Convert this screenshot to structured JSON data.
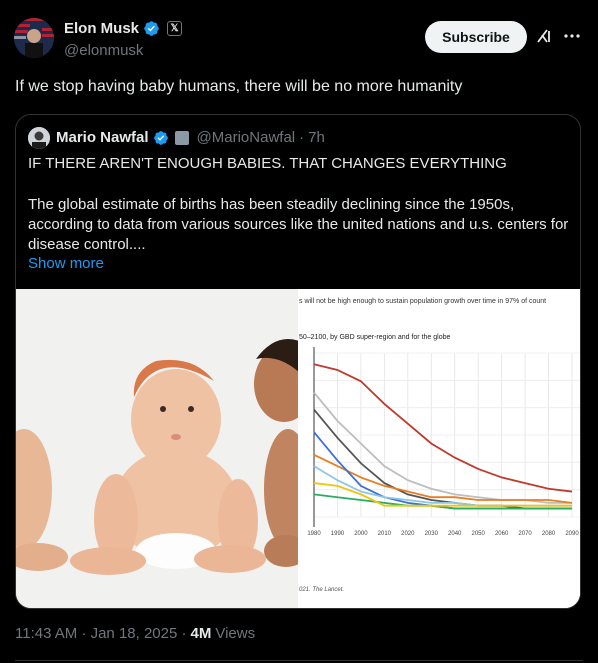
{
  "author": {
    "name": "Elon Musk",
    "handle": "@elonmusk",
    "x_badge": "𝕏"
  },
  "subscribe_label": "Subscribe",
  "post_text": "If we stop having baby humans, there will be no more humanity",
  "quote": {
    "name": "Mario Nawfal",
    "handle": "@MarioNawfal",
    "dot": "·",
    "time": "7h",
    "headline": "IF THERE AREN'T ENOUGH BABIES. THAT CHANGES EVERYTHING",
    "body": "The global estimate of births has been steadily declining since the 1950s, according to data from various sources like the united nations and u.s. centers for disease control....",
    "show_more": "Show more"
  },
  "chart_data": {
    "type": "line",
    "title": "s will not be high enough to sustain population growth over time in 97% of count",
    "subtitle": "50–2100, by GBD super-region and for the globe",
    "x_ticks": [
      "1980",
      "1990",
      "2000",
      "2010",
      "2020",
      "2030",
      "2040",
      "2050",
      "2060",
      "2070",
      "2080",
      "2090"
    ],
    "source": "021. The Lancet.",
    "series": [
      {
        "color": "#c0392b",
        "values": [
          6.6,
          6.4,
          6.0,
          5.2,
          4.5,
          3.8,
          3.3,
          2.9,
          2.6,
          2.4,
          2.2,
          2.1
        ]
      },
      {
        "color": "#bdbdbd",
        "values": [
          5.6,
          4.6,
          3.8,
          3.0,
          2.5,
          2.2,
          2.0,
          1.9,
          1.8,
          1.8,
          1.7,
          1.7
        ]
      },
      {
        "color": "#555555",
        "values": [
          5.0,
          4.0,
          3.1,
          2.4,
          2.0,
          1.8,
          1.7,
          1.6,
          1.6,
          1.5,
          1.5,
          1.5
        ]
      },
      {
        "color": "#e67e22",
        "values": [
          3.4,
          3.0,
          2.6,
          2.3,
          2.1,
          1.9,
          1.9,
          1.8,
          1.8,
          1.8,
          1.8,
          1.7
        ]
      },
      {
        "color": "#3b6fd4",
        "values": [
          4.2,
          3.2,
          2.3,
          1.9,
          1.7,
          1.6,
          1.5,
          1.5,
          1.5,
          1.5,
          1.5,
          1.5
        ]
      },
      {
        "color": "#8ec5e8",
        "values": [
          3.0,
          2.5,
          2.1,
          1.9,
          1.8,
          1.7,
          1.7,
          1.6,
          1.6,
          1.6,
          1.6,
          1.6
        ]
      },
      {
        "color": "#27ae60",
        "values": [
          2.0,
          1.9,
          1.8,
          1.7,
          1.6,
          1.6,
          1.5,
          1.5,
          1.5,
          1.5,
          1.5,
          1.5
        ]
      },
      {
        "color": "#f1c40f",
        "values": [
          2.4,
          2.3,
          2.0,
          1.6,
          1.6,
          1.6,
          1.6,
          1.6,
          1.6,
          1.6,
          1.6,
          1.6
        ]
      }
    ]
  },
  "meta": {
    "time": "11:43 AM · Jan 18, 2025 ·",
    "views_count": "4M",
    "views_label": "Views"
  }
}
